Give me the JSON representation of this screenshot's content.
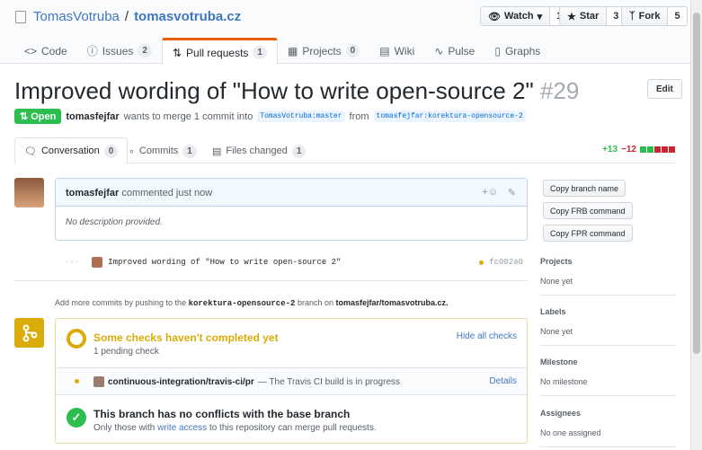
{
  "repo": {
    "owner": "TomasVotruba",
    "sep": "/",
    "name": "tomasvotruba.cz"
  },
  "actions": {
    "watch": "Watch",
    "watch_count": "1",
    "star": "Star",
    "star_count": "3",
    "fork": "Fork",
    "fork_count": "5"
  },
  "tabs": [
    {
      "label": "Code",
      "icon": "<>"
    },
    {
      "label": "Issues",
      "count": "2"
    },
    {
      "label": "Pull requests",
      "count": "1"
    },
    {
      "label": "Projects",
      "count": "0"
    },
    {
      "label": "Wiki"
    },
    {
      "label": "Pulse"
    },
    {
      "label": "Graphs"
    }
  ],
  "pr": {
    "title": "Improved wording of \"How to write open-source 2\"",
    "number": "#29",
    "edit": "Edit",
    "state": "Open",
    "author": "tomasfejfar",
    "text1": "wants to merge 1 commit into",
    "base": "TomasVotruba:master",
    "text2": "from",
    "head": "tomasfejfar:korektura-opensource-2"
  },
  "subtabs": [
    {
      "label": "Conversation",
      "count": "0"
    },
    {
      "label": "Commits",
      "count": "1"
    },
    {
      "label": "Files changed",
      "count": "1"
    }
  ],
  "diffstat": {
    "add": "+13",
    "del": "−12"
  },
  "comment": {
    "author": "tomasfejfar",
    "action": "commented just now",
    "body": "No description provided."
  },
  "commit": {
    "message": "Improved wording of \"How to write open-source 2\"",
    "sha": "fc002a0"
  },
  "hint": {
    "p1": "Add more commits by pushing to the",
    "branch": "korektura-opensource-2",
    "p2": "branch on",
    "repo": "tomasfejfar/tomasvotruba.cz."
  },
  "checks": {
    "title": "Some checks haven't completed yet",
    "sub": "1 pending check",
    "hide": "Hide all checks",
    "ci_name": "continuous-integration/travis-ci/pr",
    "ci_desc": "— The Travis CI build is in progress",
    "details": "Details",
    "ok_title": "This branch has no conflicts with the base branch",
    "ok_p1": "Only those with",
    "ok_link": "write access",
    "ok_p2": "to this repository can merge pull requests."
  },
  "sidebar": {
    "btn1": "Copy branch name",
    "btn2": "Copy FRB command",
    "btn3": "Copy FPR command",
    "projects_h": "Projects",
    "projects_v": "None yet",
    "labels_h": "Labels",
    "labels_v": "None yet",
    "milestone_h": "Milestone",
    "milestone_v": "No milestone",
    "assignees_h": "Assignees",
    "assignees_v": "No one assigned"
  }
}
